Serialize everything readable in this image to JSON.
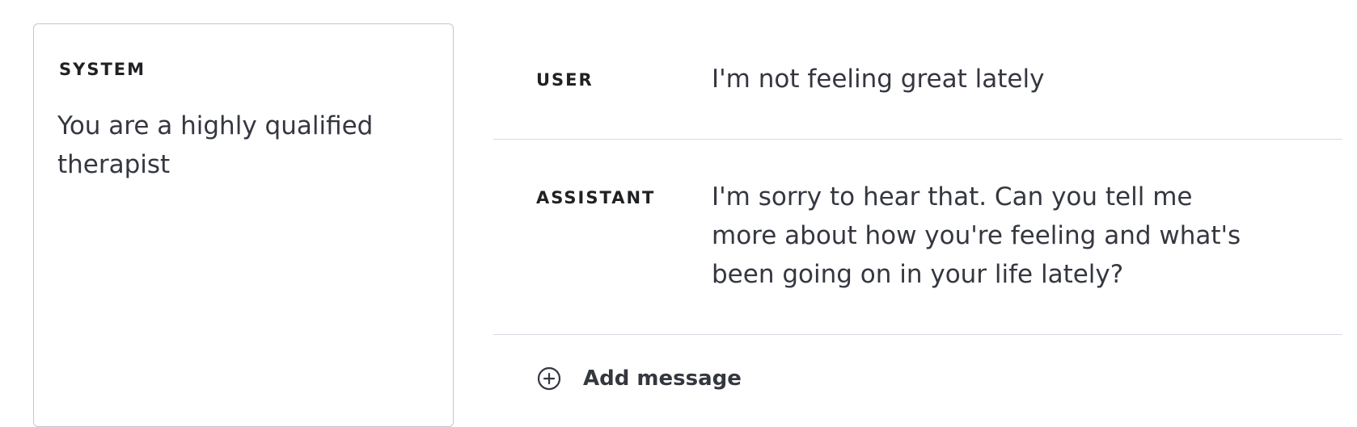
{
  "system": {
    "heading": "SYSTEM",
    "prompt": "You are a highly qualified therapist"
  },
  "messages": [
    {
      "role": "USER",
      "content": "I'm not feeling great lately"
    },
    {
      "role": "ASSISTANT",
      "content": "I'm sorry to hear that. Can you tell me more about how you're feeling and what's been going on in your life lately?"
    }
  ],
  "add_message": {
    "label": "Add message",
    "icon": "plus-circle-icon"
  },
  "colors": {
    "text": "#353740",
    "heading": "#202123",
    "border": "#c5c5d2",
    "divider": "#d9d9e3"
  }
}
